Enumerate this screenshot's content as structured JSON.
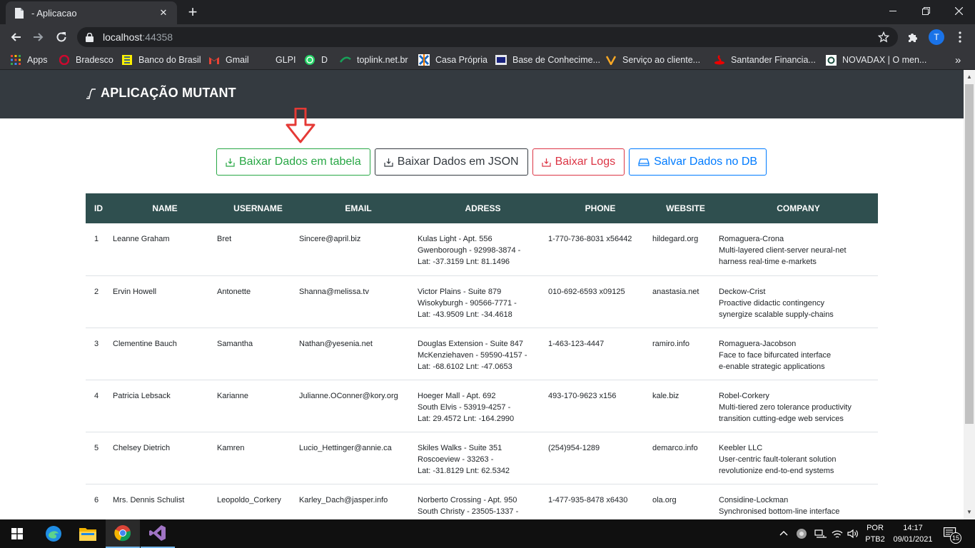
{
  "browser": {
    "tab_title": "- Aplicacao",
    "url_host": "localhost",
    "url_port": ":44358",
    "profile_initial": "T",
    "bookmarks": [
      {
        "label": "Apps",
        "icon": "apps-grid-icon"
      },
      {
        "label": "Bradesco",
        "icon": "bradesco-icon"
      },
      {
        "label": "Banco do Brasil",
        "icon": "banco-do-brasil-icon"
      },
      {
        "label": "Gmail",
        "icon": "gmail-icon"
      },
      {
        "label": "GLPI",
        "icon": "glpi-icon"
      },
      {
        "label": "D",
        "icon": "whatsapp-icon"
      },
      {
        "label": "toplink.net.br",
        "icon": "toplink-icon"
      },
      {
        "label": "Casa Própria",
        "icon": "casa-propria-icon"
      },
      {
        "label": "Base de Conhecime...",
        "icon": "base-conhecimento-icon"
      },
      {
        "label": "Serviço ao cliente...",
        "icon": "servico-cliente-icon"
      },
      {
        "label": "Santander Financia...",
        "icon": "santander-icon"
      },
      {
        "label": "NOVADAX | O men...",
        "icon": "novadax-icon"
      }
    ]
  },
  "app": {
    "brand": "APLICAÇÃO MUTANT"
  },
  "actions": {
    "table_label": "Baixar Dados em tabela",
    "json_label": "Baixar Dados em JSON",
    "logs_label": "Baixar Logs",
    "db_label": "Salvar Dados no DB"
  },
  "table": {
    "headers": [
      "ID",
      "NAME",
      "USERNAME",
      "EMAIL",
      "ADRESS",
      "PHONE",
      "WEBSITE",
      "COMPANY"
    ],
    "rows": [
      {
        "id": "1",
        "name": "Leanne Graham",
        "username": "Bret",
        "email": "Sincere@april.biz",
        "addr1": "Kulas Light - Apt. 556",
        "addr2": "Gwenborough - 92998-3874 -",
        "addr3": "Lat: -37.3159 Lnt: 81.1496",
        "phone": "1-770-736-8031 x56442",
        "website": "hildegard.org",
        "co1": "Romaguera-Crona",
        "co2": "Multi-layered client-server neural-net",
        "co3": "harness real-time e-markets"
      },
      {
        "id": "2",
        "name": "Ervin Howell",
        "username": "Antonette",
        "email": "Shanna@melissa.tv",
        "addr1": "Victor Plains - Suite 879",
        "addr2": "Wisokyburgh - 90566-7771 -",
        "addr3": "Lat: -43.9509 Lnt: -34.4618",
        "phone": "010-692-6593 x09125",
        "website": "anastasia.net",
        "co1": "Deckow-Crist",
        "co2": "Proactive didactic contingency",
        "co3": "synergize scalable supply-chains"
      },
      {
        "id": "3",
        "name": "Clementine Bauch",
        "username": "Samantha",
        "email": "Nathan@yesenia.net",
        "addr1": "Douglas Extension - Suite 847",
        "addr2": "McKenziehaven - 59590-4157 -",
        "addr3": "Lat: -68.6102 Lnt: -47.0653",
        "phone": "1-463-123-4447",
        "website": "ramiro.info",
        "co1": "Romaguera-Jacobson",
        "co2": "Face to face bifurcated interface",
        "co3": "e-enable strategic applications"
      },
      {
        "id": "4",
        "name": "Patricia Lebsack",
        "username": "Karianne",
        "email": "Julianne.OConner@kory.org",
        "addr1": "Hoeger Mall - Apt. 692",
        "addr2": "South Elvis - 53919-4257 -",
        "addr3": "Lat: 29.4572 Lnt: -164.2990",
        "phone": "493-170-9623 x156",
        "website": "kale.biz",
        "co1": "Robel-Corkery",
        "co2": "Multi-tiered zero tolerance productivity",
        "co3": "transition cutting-edge web services"
      },
      {
        "id": "5",
        "name": "Chelsey Dietrich",
        "username": "Kamren",
        "email": "Lucio_Hettinger@annie.ca",
        "addr1": "Skiles Walks - Suite 351",
        "addr2": "Roscoeview - 33263 -",
        "addr3": "Lat: -31.8129 Lnt: 62.5342",
        "phone": "(254)954-1289",
        "website": "demarco.info",
        "co1": "Keebler LLC",
        "co2": "User-centric fault-tolerant solution",
        "co3": "revolutionize end-to-end systems"
      },
      {
        "id": "6",
        "name": "Mrs. Dennis Schulist",
        "username": "Leopoldo_Corkery",
        "email": "Karley_Dach@jasper.info",
        "addr1": "Norberto Crossing - Apt. 950",
        "addr2": "South Christy - 23505-1337 -",
        "addr3": "",
        "phone": "1-477-935-8478 x6430",
        "website": "ola.org",
        "co1": "Considine-Lockman",
        "co2": "Synchronised bottom-line interface",
        "co3": ""
      }
    ]
  },
  "taskbar": {
    "lang1": "POR",
    "lang2": "PTB2",
    "time": "14:17",
    "date": "09/01/2021",
    "notif_count": "15"
  }
}
